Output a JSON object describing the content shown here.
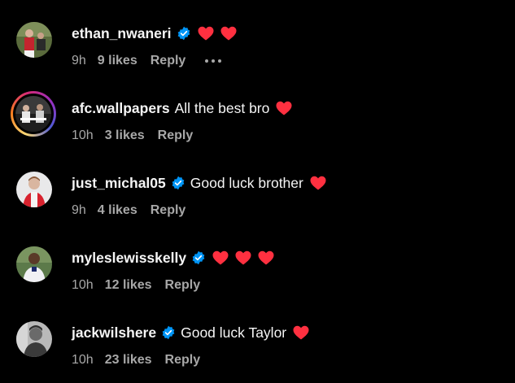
{
  "colors": {
    "background": "#000000",
    "primary_text": "#f5f5f5",
    "secondary_text": "#a8a8a8",
    "verified_blue": "#0095f6",
    "heart_red": "#ff3040"
  },
  "comments": [
    {
      "username": "ethan_nwaneri",
      "verified": true,
      "text": "",
      "hearts": 2,
      "time": "9h",
      "likes": "9 likes",
      "reply": "Reply",
      "more_icon": "more-options-icon"
    },
    {
      "username": "afc.wallpapers",
      "verified": false,
      "text": "All the best bro",
      "hearts": 1,
      "time": "10h",
      "likes": "3 likes",
      "reply": "Reply"
    },
    {
      "username": "just_michal05",
      "verified": true,
      "text": "Good luck brother",
      "hearts": 1,
      "time": "9h",
      "likes": "4 likes",
      "reply": "Reply"
    },
    {
      "username": "myleslewisskelly",
      "verified": true,
      "text": "",
      "hearts": 3,
      "time": "10h",
      "likes": "12 likes",
      "reply": "Reply"
    },
    {
      "username": "jackwilshere",
      "verified": true,
      "text": "Good luck Taylor",
      "hearts": 1,
      "time": "10h",
      "likes": "23 likes",
      "reply": "Reply"
    }
  ]
}
